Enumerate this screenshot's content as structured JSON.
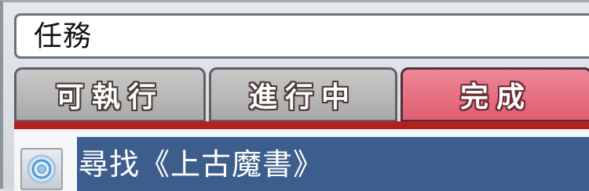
{
  "window": {
    "title": "任務"
  },
  "tabs": [
    {
      "label": "可執行",
      "active": false
    },
    {
      "label": "進行中",
      "active": false
    },
    {
      "label": "完成",
      "active": true
    }
  ],
  "quests": [
    {
      "name": "尋找《上古魔書》",
      "icon": "quest-target-icon",
      "selected": true
    }
  ],
  "colors": {
    "active_tab": "#e0677a",
    "inactive_tab": "#b9b9b9",
    "tab_underline": "#b3211f",
    "selected_row": "#3d5e8c"
  }
}
